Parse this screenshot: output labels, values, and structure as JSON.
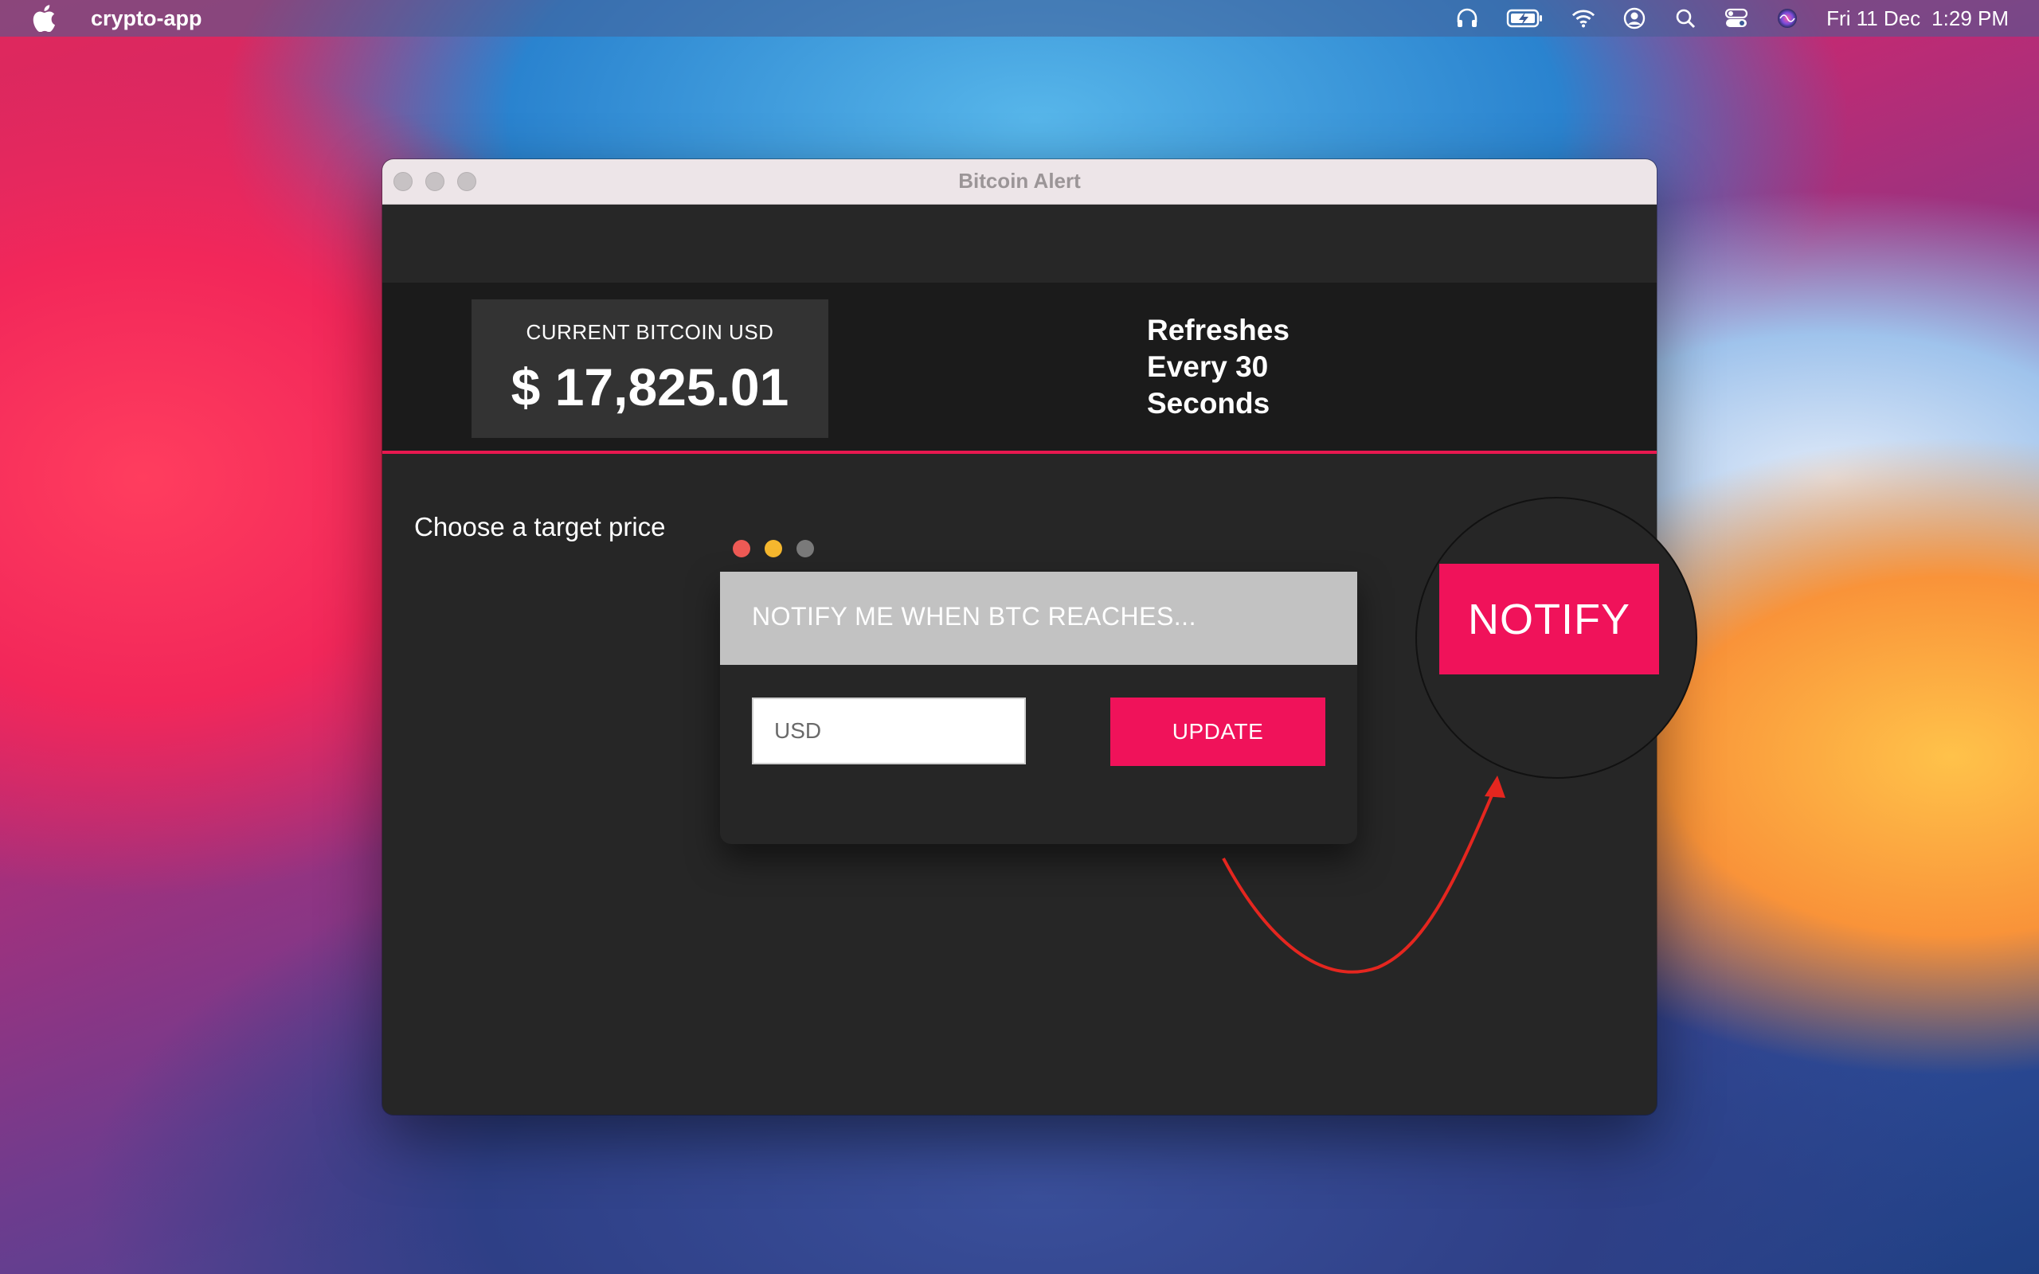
{
  "menubar": {
    "app_name": "crypto-app",
    "icons": [
      "apple-icon",
      "headphones-icon",
      "battery-icon",
      "wifi-icon",
      "user-icon",
      "search-icon",
      "control-center-icon",
      "siri-icon"
    ],
    "date": "Fri 11 Dec",
    "time": "1:29 PM"
  },
  "window": {
    "title": "Bitcoin Alert"
  },
  "header": {
    "price_label": "CURRENT BITCOIN USD",
    "price_value": "$ 17,825.01",
    "refresh_line1": "Refreshes",
    "refresh_line2": "Every 30",
    "refresh_line3": "Seconds"
  },
  "main": {
    "choose_label": "Choose a target price",
    "panel_title": "NOTIFY ME WHEN BTC REACHES...",
    "input_placeholder": "USD",
    "update_label": "UPDATE",
    "notify_label": "NOTIFY"
  },
  "colors": {
    "accent": "#f0125a",
    "window_bg": "#262626",
    "header_bg": "#1b1b1b",
    "panel_head": "#c2c2c2",
    "arrow": "#e5261f"
  }
}
